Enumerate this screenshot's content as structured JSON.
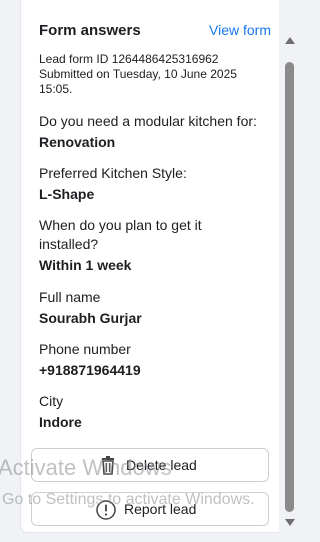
{
  "form": {
    "title": "Form answers",
    "view_link": "View form",
    "lead_id_line": "Lead form ID 1264486425316962",
    "submitted_line1": "Submitted on Tuesday, 10 June 2025",
    "submitted_line2": "15:05."
  },
  "answers": [
    {
      "question": "Do you need a modular kitchen for:",
      "answer": "Renovation"
    },
    {
      "question": "Preferred Kitchen Style:",
      "answer": "L-Shape"
    },
    {
      "question": "When do you plan to get it installed?",
      "answer": "Within 1 week"
    },
    {
      "question": "Full name",
      "answer": "Sourabh Gurjar"
    },
    {
      "question": "Phone number",
      "answer": "+918871964419"
    },
    {
      "question": "City",
      "answer": "Indore"
    }
  ],
  "actions": {
    "delete_label": "Delete lead",
    "report_label": "Report lead"
  },
  "watermark": {
    "line1": "Activate Windows",
    "line2": "Go to Settings to activate Windows."
  },
  "icons": {
    "delete": "trash-icon",
    "report": "exclamation-circle-icon"
  },
  "colors": {
    "link": "#1877f2"
  }
}
